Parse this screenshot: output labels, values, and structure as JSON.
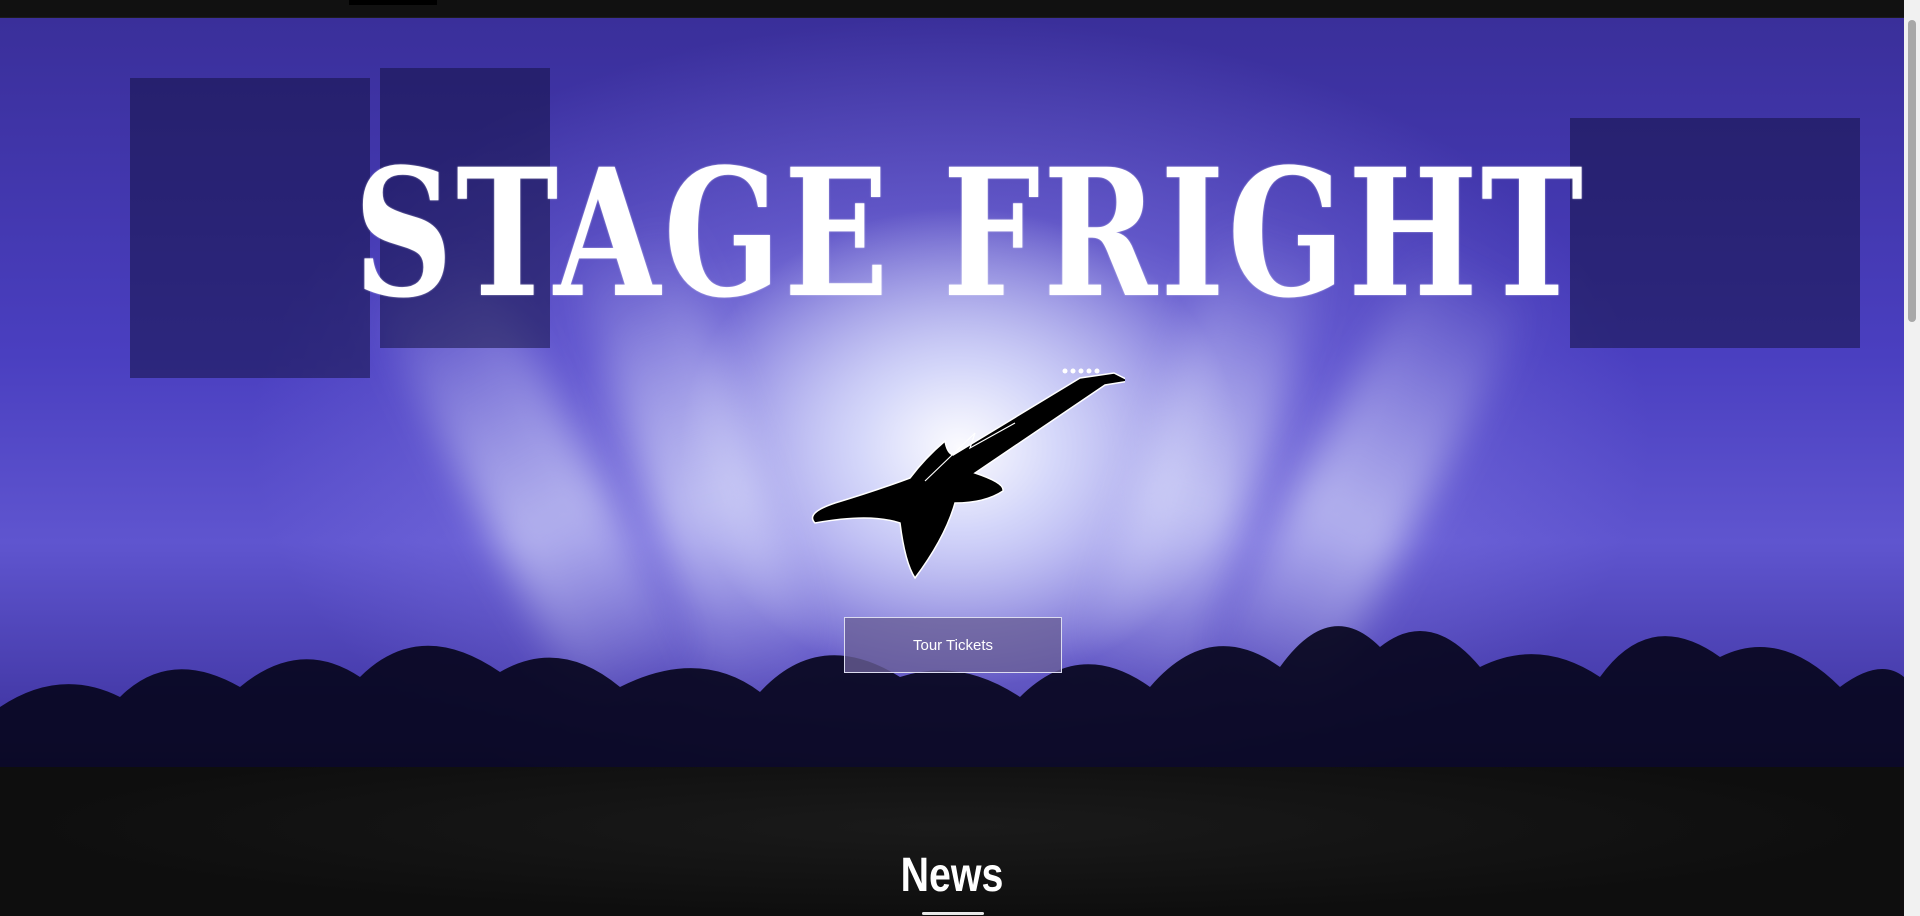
{
  "hero": {
    "band_logo_text": "STAGE FRIGHT",
    "tour_button_label": "Tour Tickets"
  },
  "news": {
    "heading": "News"
  },
  "icons": {
    "hero_graphic": "guitar-icon"
  },
  "colors": {
    "hero_base": "#4a3fc0",
    "page_background": "#0d0d0d",
    "button_background": "#695f96",
    "text": "#ffffff"
  }
}
